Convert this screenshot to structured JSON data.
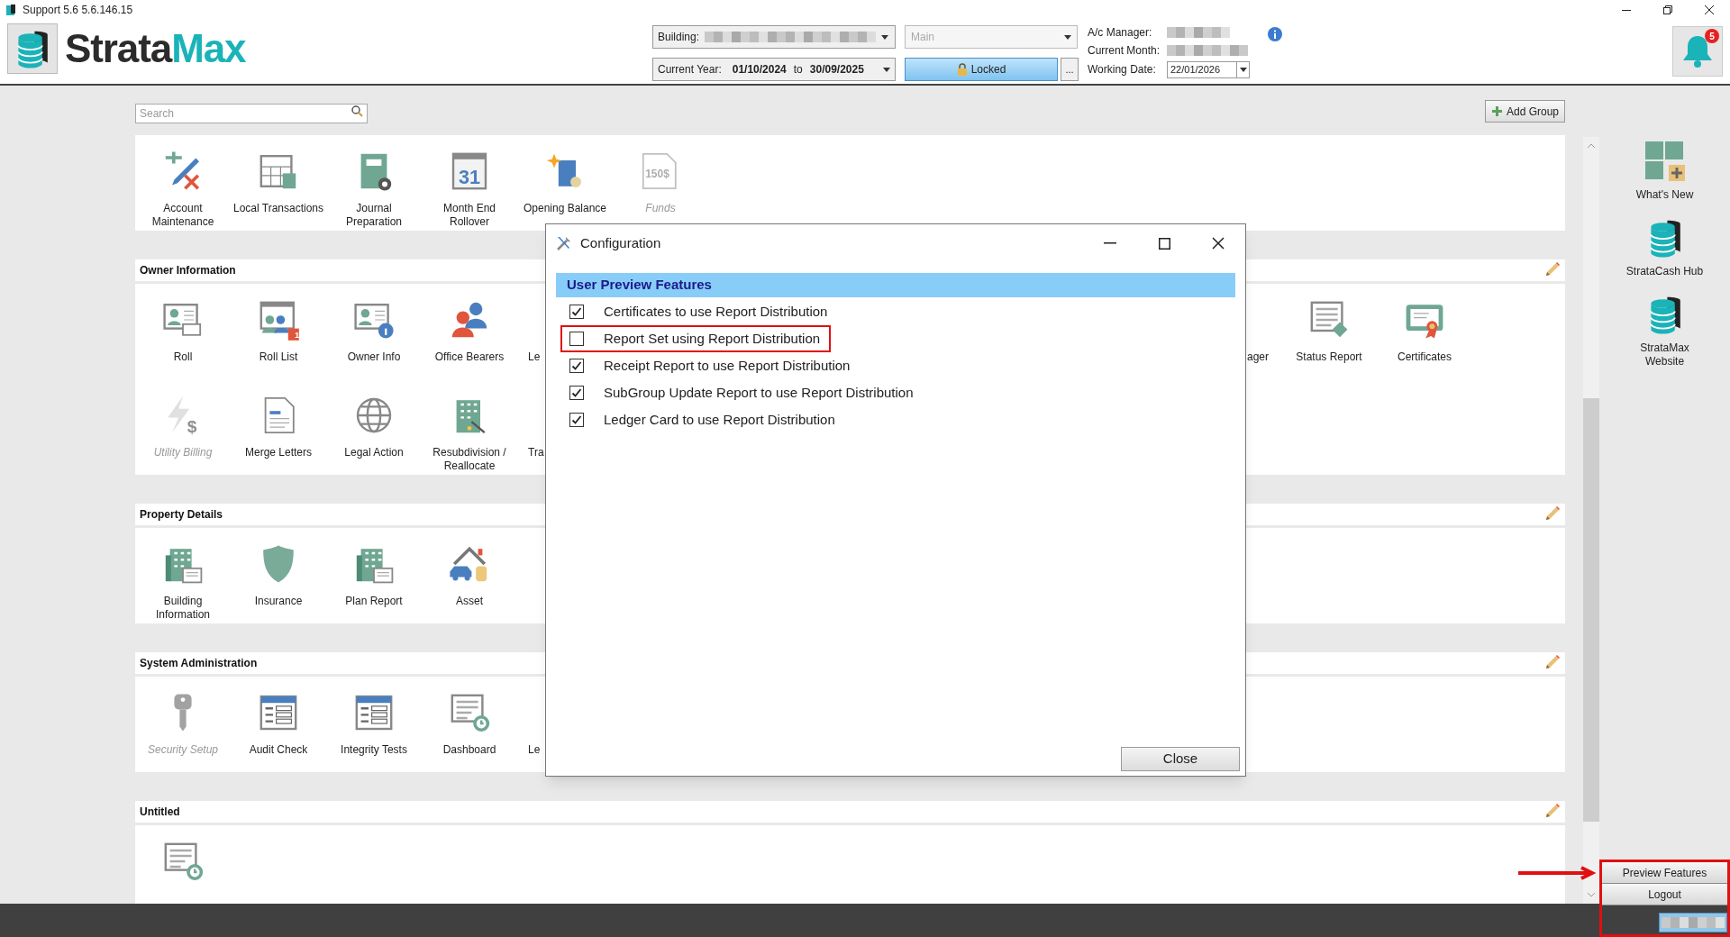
{
  "title_bar": {
    "title": "Support 5.6 5.6.146.15"
  },
  "header": {
    "logo": {
      "part_1": "Strata",
      "part_2": "Max"
    },
    "building": {
      "label": "Building:"
    },
    "branch": {
      "value": "Main",
      "disabled": true
    },
    "current_year": {
      "label": "Current Year:",
      "from": "01/10/2024",
      "to_label": "to",
      "to": "30/09/2025"
    },
    "lock_button": {
      "label": "Locked"
    },
    "more_button": {
      "label": "..."
    },
    "ac_manager": {
      "label": "A/c Manager:"
    },
    "current_month": {
      "label": "Current Month:"
    },
    "working_date": {
      "label": "Working Date:",
      "value": "22/01/2026"
    },
    "notifications": {
      "count": "5"
    }
  },
  "search": {
    "placeholder": "Search"
  },
  "add_group_button": {
    "label": "Add Group"
  },
  "sections": [
    {
      "tiles": [
        {
          "kind": "tile",
          "label": "Account Maintenance",
          "disabled": false
        },
        {
          "kind": "tile",
          "label": "Local Transactions",
          "disabled": false
        },
        {
          "kind": "tile",
          "label": "Journal Preparation",
          "disabled": false
        },
        {
          "kind": "tile",
          "label": "Month End Rollover",
          "disabled": false,
          "icon_text": "31"
        },
        {
          "kind": "tile",
          "label": "Opening Balance",
          "disabled": false
        },
        {
          "kind": "tile",
          "label": "Funds",
          "disabled": true,
          "icon_text": "150$"
        }
      ]
    },
    {
      "title": "Owner Information",
      "editable": true,
      "rows": [
        {
          "tiles": [
            {
              "kind": "tile",
              "label": "Roll",
              "disabled": false
            },
            {
              "kind": "tile",
              "label": "Roll List",
              "disabled": false,
              "icon_text": "1"
            },
            {
              "kind": "tile",
              "label": "Owner Info",
              "disabled": false
            },
            {
              "kind": "tile",
              "label": "Office Bearers",
              "disabled": false
            },
            {
              "kind": "cut",
              "label": "Le"
            }
          ],
          "tiles_right": [
            {
              "kind": "cut",
              "label": "ager"
            },
            {
              "kind": "tile",
              "label": "Status Report",
              "disabled": false
            },
            {
              "kind": "tile",
              "label": "Certificates",
              "disabled": false
            }
          ]
        },
        {
          "tiles": [
            {
              "kind": "tile",
              "label": "Utility Billing",
              "disabled": true,
              "icon_text": "$"
            },
            {
              "kind": "tile",
              "label": "Merge Letters",
              "disabled": false
            },
            {
              "kind": "tile",
              "label": "Legal Action",
              "disabled": false
            },
            {
              "kind": "tile",
              "label": "Resubdivision / Reallocate",
              "disabled": false
            },
            {
              "kind": "cut",
              "label": "Tra"
            }
          ]
        }
      ]
    },
    {
      "title": "Property Details",
      "editable": true,
      "tiles": [
        {
          "kind": "tile",
          "label": "Building Information",
          "disabled": false
        },
        {
          "kind": "tile",
          "label": "Insurance",
          "disabled": false
        },
        {
          "kind": "tile",
          "label": "Plan Report",
          "disabled": false
        },
        {
          "kind": "tile",
          "label": "Asset",
          "disabled": false
        }
      ]
    },
    {
      "title": "System Administration",
      "editable": true,
      "tiles": [
        {
          "kind": "tile",
          "label": "Security Setup",
          "disabled": true
        },
        {
          "kind": "tile",
          "label": "Audit Check",
          "disabled": false
        },
        {
          "kind": "tile",
          "label": "Integrity Tests",
          "disabled": false
        },
        {
          "kind": "tile",
          "label": "Dashboard",
          "disabled": false
        },
        {
          "kind": "cut",
          "label": "Le"
        }
      ]
    },
    {
      "title": "Untitled",
      "editable": true,
      "tiles": [
        {
          "kind": "tile",
          "disabled": false
        }
      ]
    }
  ],
  "dialog": {
    "title": "Configuration",
    "group_title": "User Preview Features",
    "options": [
      {
        "label": "Certificates to use Report Distribution",
        "checked": true,
        "highlighted": false
      },
      {
        "label": "Report Set using Report Distribution",
        "checked": false,
        "highlighted": true
      },
      {
        "label": "Receipt Report to use Report Distribution",
        "checked": true,
        "highlighted": false
      },
      {
        "label": "SubGroup Update Report to use Report Distribution",
        "checked": true,
        "highlighted": false
      },
      {
        "label": "Ledger Card to use Report Distribution",
        "checked": true,
        "highlighted": false
      }
    ],
    "close_button": {
      "label": "Close"
    }
  },
  "sidebar": {
    "items": [
      {
        "label": "What's New"
      },
      {
        "label": "StrataCash Hub"
      },
      {
        "label": "StrataMax Website"
      }
    ],
    "footer": {
      "highlighted": true,
      "buttons": [
        {
          "label": "Preview Features"
        },
        {
          "label": "Logout"
        }
      ]
    }
  }
}
